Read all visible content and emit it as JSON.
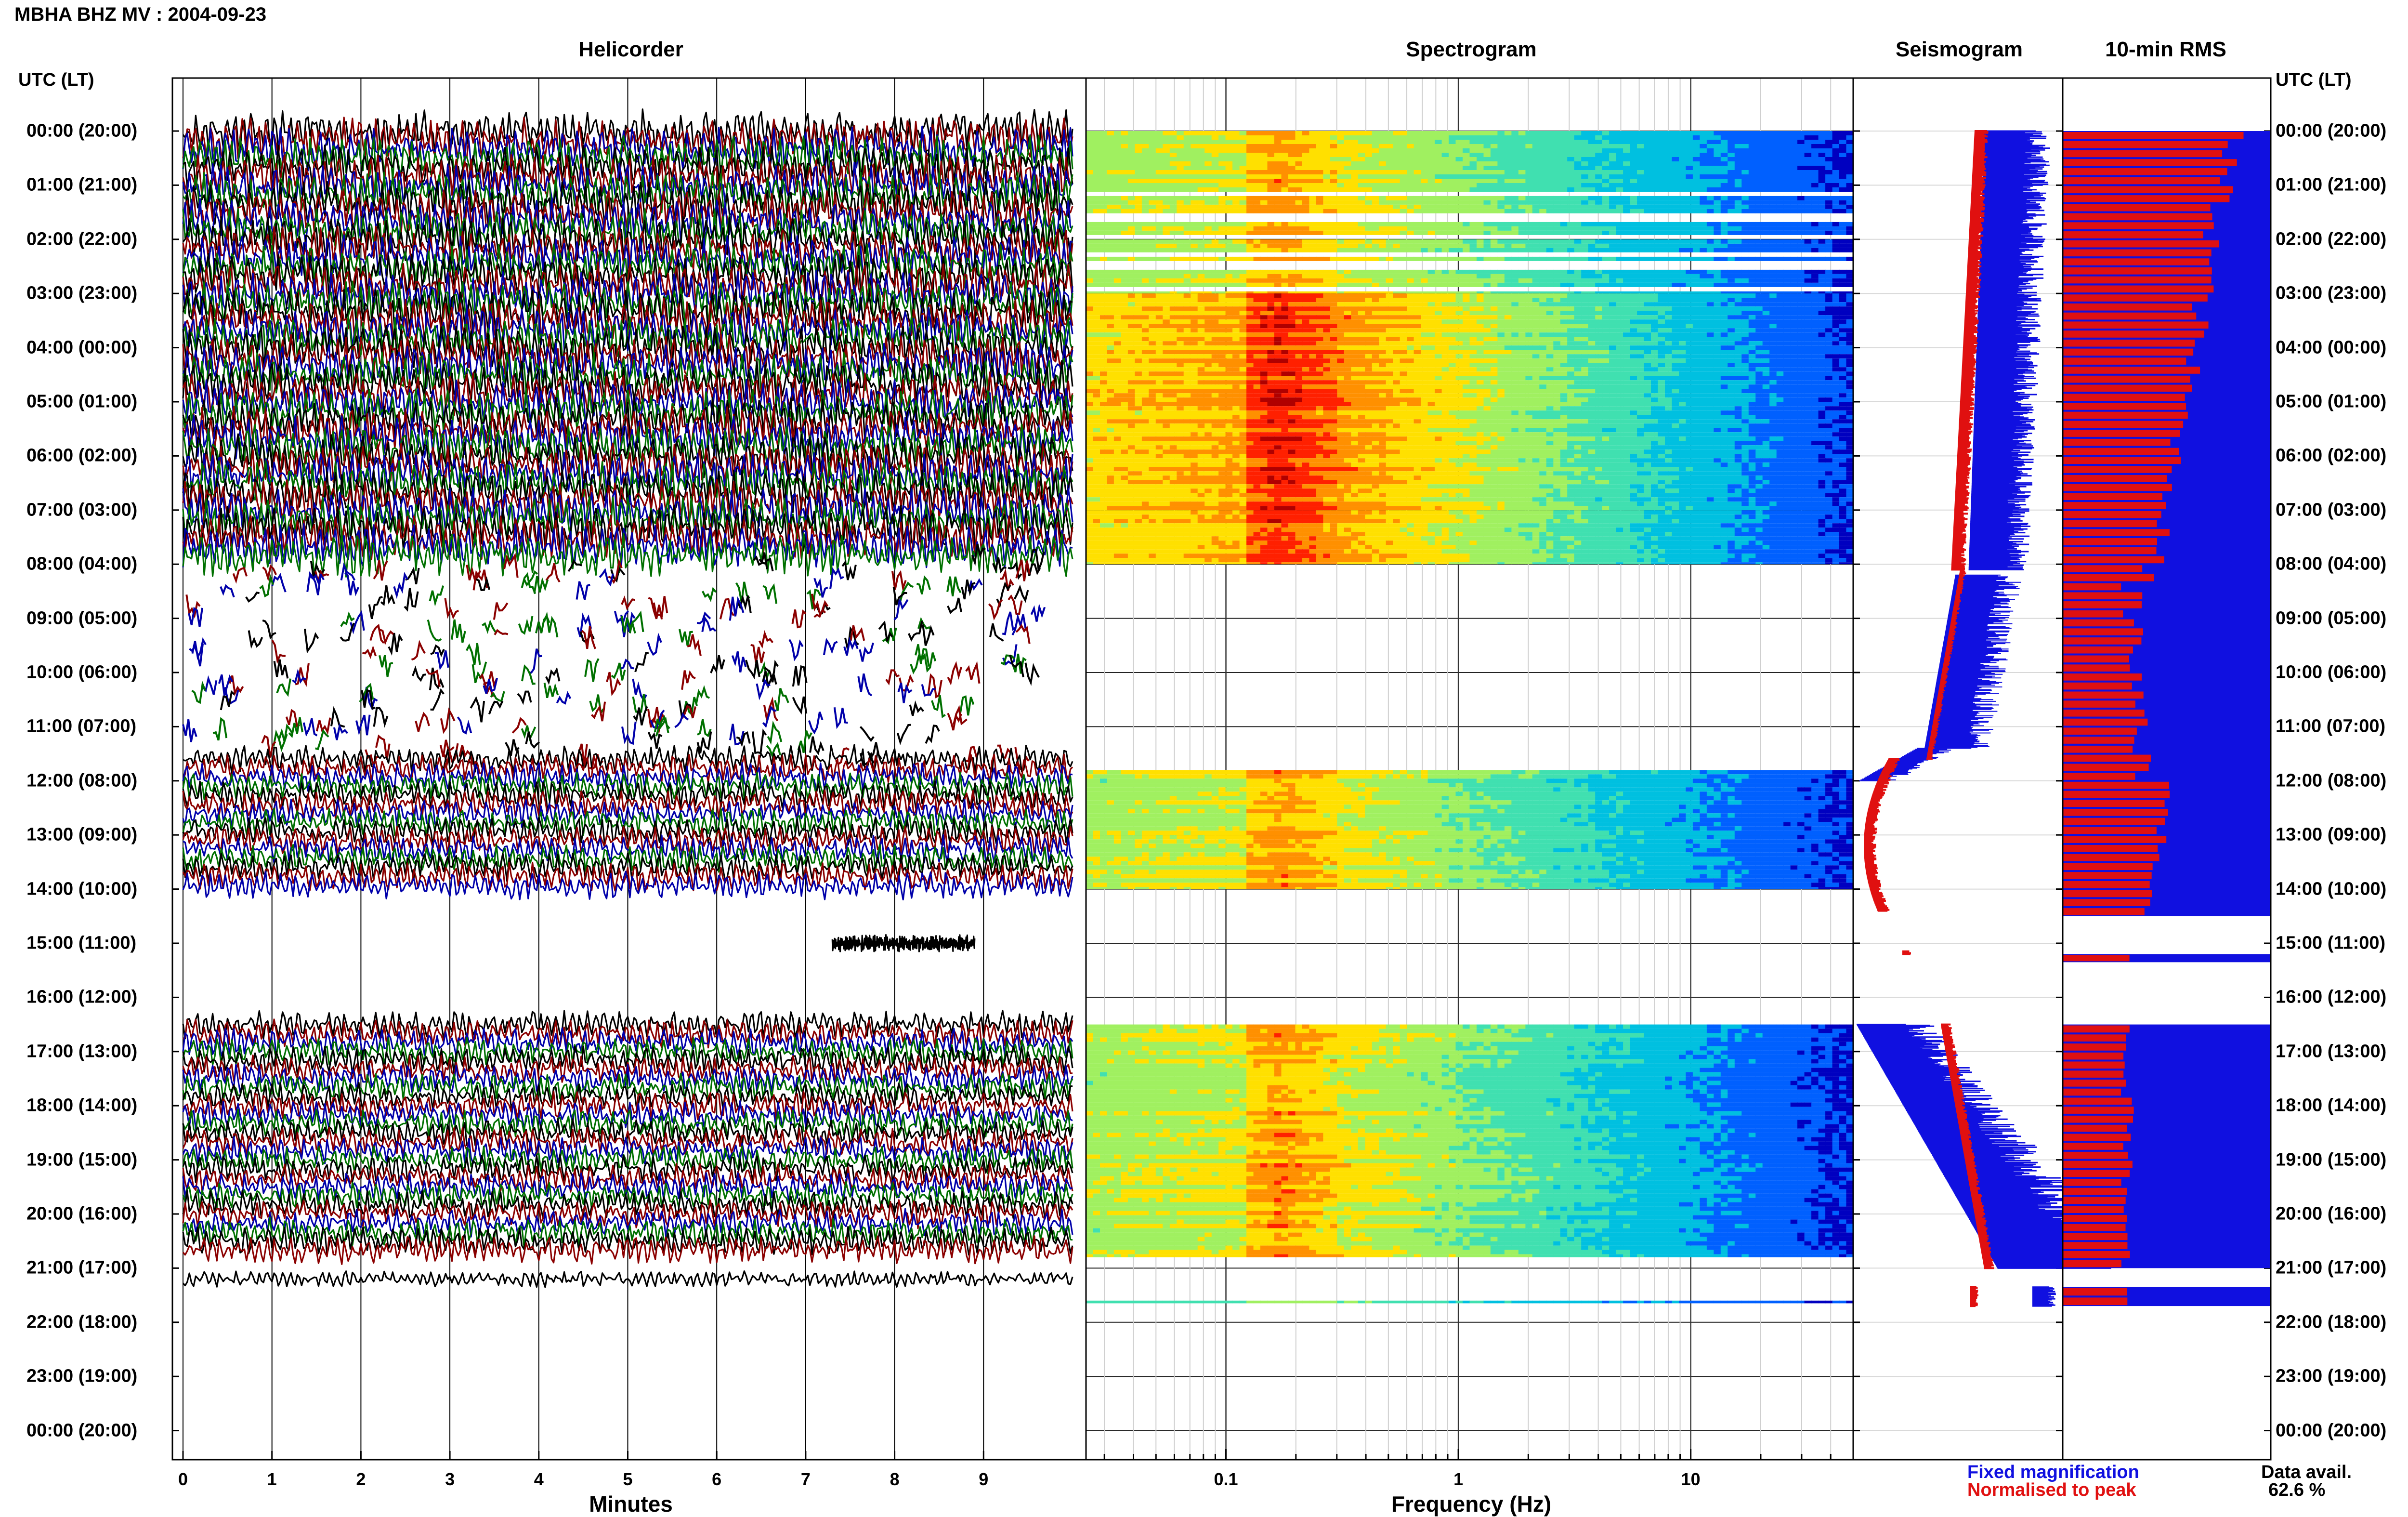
{
  "title": "MBHA BHZ MV : 2004-09-23",
  "panels": {
    "helicorder": "Helicorder",
    "spectrogram": "Spectrogram",
    "seismogram": "Seismogram",
    "rms": "10-min RMS"
  },
  "time_axis_header": "UTC (LT)",
  "legend": {
    "fixed": "Fixed magnification",
    "normalised": "Normalised to peak",
    "fixed_color": "#1010e0",
    "normalised_color": "#e01010"
  },
  "data_availability": {
    "label": "Data avail.",
    "value": "62.6 %"
  },
  "chart_data": [
    {
      "type": "line",
      "panel": "Helicorder",
      "xlabel": "Minutes",
      "xlim": [
        0,
        10
      ],
      "x_ticks": [
        "0",
        "1",
        "2",
        "3",
        "4",
        "5",
        "6",
        "7",
        "8",
        "9"
      ],
      "y_ticks": [
        "00:00 (20:00)",
        "01:00 (21:00)",
        "02:00 (22:00)",
        "03:00 (23:00)",
        "04:00 (00:00)",
        "05:00 (01:00)",
        "06:00 (02:00)",
        "07:00 (03:00)",
        "08:00 (04:00)",
        "09:00 (05:00)",
        "10:00 (06:00)",
        "11:00 (07:00)",
        "12:00 (08:00)",
        "13:00 (09:00)",
        "14:00 (10:00)",
        "15:00 (11:00)",
        "16:00 (12:00)",
        "17:00 (13:00)",
        "18:00 (14:00)",
        "19:00 (15:00)",
        "20:00 (16:00)",
        "21:00 (17:00)",
        "22:00 (18:00)",
        "23:00 (19:00)",
        "00:00 (20:00)"
      ],
      "trace_colors": [
        "#000000",
        "#8b0000",
        "#0000aa",
        "#007000"
      ],
      "segments_utc_hours": [
        {
          "start": 0.0,
          "end": 8.0,
          "style": "continuous",
          "amplitude": "high"
        },
        {
          "start": 8.0,
          "end": 11.6,
          "style": "fragmented",
          "amplitude": "low"
        },
        {
          "start": 11.6,
          "end": 14.1,
          "style": "continuous",
          "amplitude": "medium"
        },
        {
          "start": 15.0,
          "end": 15.1,
          "style": "short",
          "amplitude": "low",
          "x_range": [
            7.3,
            8.9
          ]
        },
        {
          "start": 16.5,
          "end": 20.9,
          "style": "continuous",
          "amplitude": "medium"
        },
        {
          "start": 21.2,
          "end": 21.4,
          "style": "continuous",
          "amplitude": "low"
        }
      ]
    },
    {
      "type": "heatmap",
      "panel": "Spectrogram",
      "xlabel": "Frequency (Hz)",
      "x_scale": "log",
      "xlim": [
        0.025,
        50
      ],
      "x_ticks": [
        "0.1",
        "1",
        "10"
      ],
      "colormap": [
        "#0000c0",
        "#0060ff",
        "#00c0e0",
        "#40e0b0",
        "#a0f060",
        "#ffe000",
        "#ff9000",
        "#ff2000",
        "#b00000"
      ],
      "bands_utc_hours": [
        {
          "start": 0.0,
          "end": 1.2,
          "intensity": "striped"
        },
        {
          "start": 1.2,
          "end": 3.0,
          "intensity": "striped"
        },
        {
          "start": 3.0,
          "end": 8.0,
          "intensity": "high"
        },
        {
          "start": 11.8,
          "end": 14.0,
          "intensity": "medium"
        },
        {
          "start": 16.5,
          "end": 20.8,
          "intensity": "medium"
        },
        {
          "start": 21.6,
          "end": 21.65,
          "intensity": "thin"
        }
      ],
      "peak_frequency_hz": 0.17
    },
    {
      "type": "line",
      "panel": "Seismogram",
      "series": [
        {
          "name": "Fixed magnification",
          "color": "#1010e0"
        },
        {
          "name": "Normalised to peak",
          "color": "#e01010"
        }
      ]
    },
    {
      "type": "bar",
      "panel": "10-min RMS",
      "orientation": "horizontal",
      "interval_minutes": 10,
      "series": [
        {
          "name": "Fixed magnification",
          "color": "#1010e0"
        },
        {
          "name": "Normalised to peak",
          "color": "#e01010"
        }
      ],
      "segments_utc_hours": [
        {
          "start": 0.0,
          "end": 14.5
        },
        {
          "start": 15.2,
          "end": 15.35
        },
        {
          "start": 16.5,
          "end": 21.0
        },
        {
          "start": 21.35,
          "end": 21.7
        }
      ]
    }
  ]
}
